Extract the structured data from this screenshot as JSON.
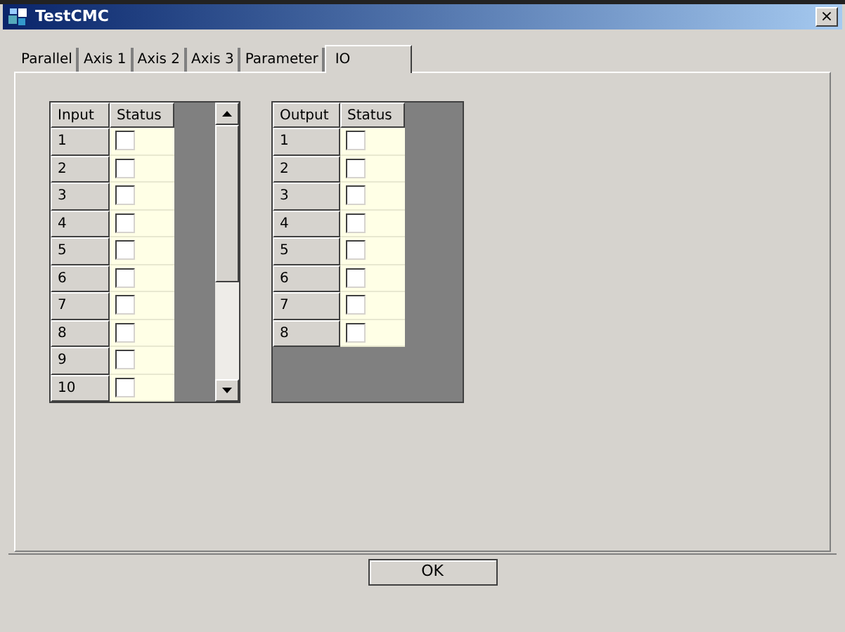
{
  "window": {
    "title": "TestCMC",
    "close": "×"
  },
  "tabs": [
    {
      "label": "Parallel",
      "selected": false
    },
    {
      "label": "Axis 1",
      "selected": false
    },
    {
      "label": "Axis 2",
      "selected": false
    },
    {
      "label": "Axis 3",
      "selected": false
    },
    {
      "label": "Parameter",
      "selected": false
    },
    {
      "label": "IO",
      "selected": true
    }
  ],
  "input_table": {
    "columns": [
      "Input",
      "Status"
    ],
    "rows": [
      {
        "label": "1",
        "checked": false
      },
      {
        "label": "2",
        "checked": false
      },
      {
        "label": "3",
        "checked": false
      },
      {
        "label": "4",
        "checked": false
      },
      {
        "label": "5",
        "checked": false
      },
      {
        "label": "6",
        "checked": false
      },
      {
        "label": "7",
        "checked": false
      },
      {
        "label": "8",
        "checked": false
      },
      {
        "label": "9",
        "checked": false
      },
      {
        "label": "10",
        "checked": false
      }
    ]
  },
  "output_table": {
    "columns": [
      "Output",
      "Status"
    ],
    "rows": [
      {
        "label": "1",
        "checked": false
      },
      {
        "label": "2",
        "checked": false
      },
      {
        "label": "3",
        "checked": false
      },
      {
        "label": "4",
        "checked": false
      },
      {
        "label": "5",
        "checked": false
      },
      {
        "label": "6",
        "checked": false
      },
      {
        "label": "7",
        "checked": false
      },
      {
        "label": "8",
        "checked": false
      }
    ]
  },
  "buttons": [
    "OK"
  ]
}
